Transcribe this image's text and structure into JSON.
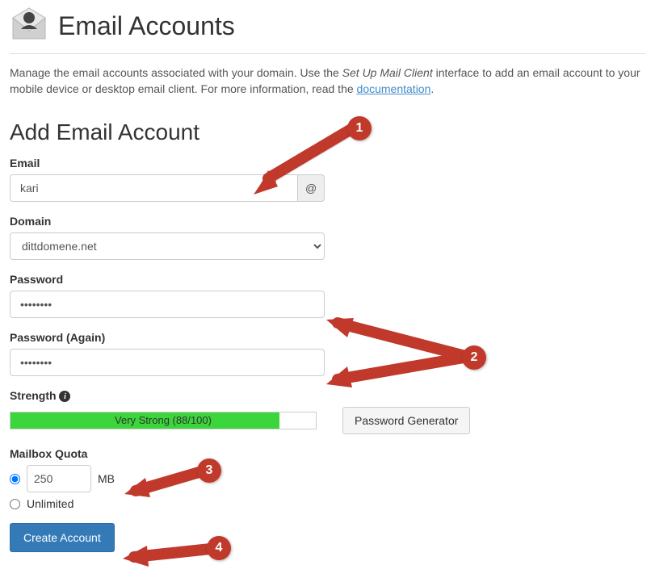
{
  "header": {
    "title": "Email Accounts"
  },
  "intro": {
    "text_before": "Manage the email accounts associated with your domain. Use the ",
    "emphasis": "Set Up Mail Client",
    "text_mid": " interface to add an email account to your mobile device or desktop email client. For more information, read the ",
    "link_text": "documentation",
    "text_after": "."
  },
  "section_title": "Add Email Account",
  "fields": {
    "email_label": "Email",
    "email_value": "kari",
    "email_addon": "@",
    "domain_label": "Domain",
    "domain_value": "dittdomene.net",
    "password_label": "Password",
    "password_value": "••••••••",
    "password2_label": "Password (Again)",
    "password2_value": "••••••••",
    "strength_label": "Strength",
    "strength_text": "Very Strong (88/100)",
    "strength_percent": 88,
    "pwgen_label": "Password Generator",
    "quota_label": "Mailbox Quota",
    "quota_value": "250",
    "quota_unit": "MB",
    "quota_unlimited": "Unlimited",
    "submit_label": "Create Account"
  },
  "callouts": {
    "c1": "1",
    "c2": "2",
    "c3": "3",
    "c4": "4"
  }
}
